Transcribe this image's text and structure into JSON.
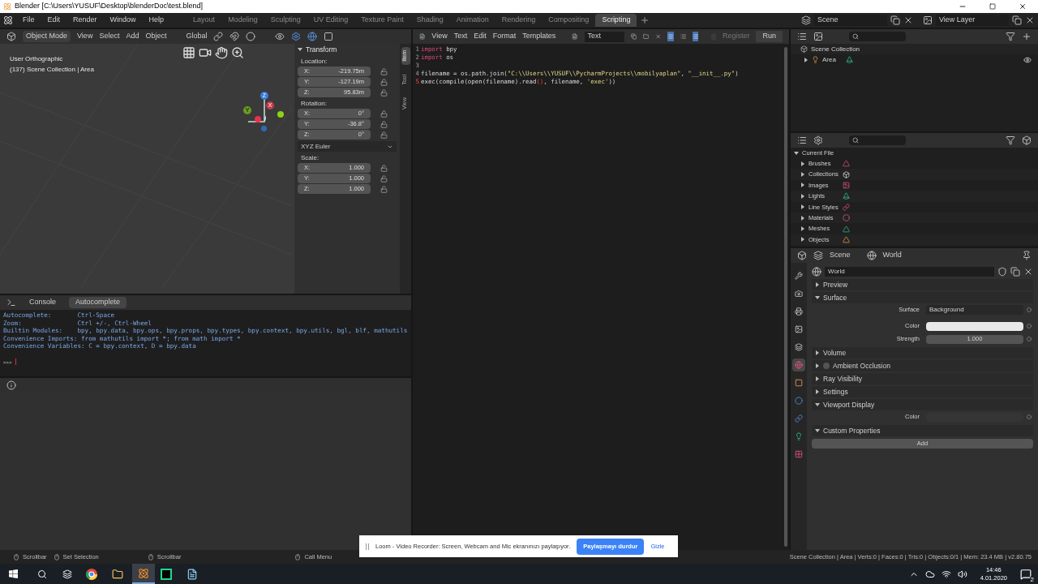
{
  "window": {
    "title": "Blender [C:\\Users\\YUSUF\\Desktop\\blenderDoc\\test.blend]"
  },
  "menu": [
    "File",
    "Edit",
    "Render",
    "Window",
    "Help"
  ],
  "workspaces": [
    {
      "label": "Layout",
      "selected": false
    },
    {
      "label": "Modeling",
      "selected": false
    },
    {
      "label": "Sculpting",
      "selected": false
    },
    {
      "label": "UV Editing",
      "selected": false
    },
    {
      "label": "Texture Paint",
      "selected": false
    },
    {
      "label": "Shading",
      "selected": false
    },
    {
      "label": "Animation",
      "selected": false
    },
    {
      "label": "Rendering",
      "selected": false
    },
    {
      "label": "Compositing",
      "selected": false
    },
    {
      "label": "Scripting",
      "selected": true
    }
  ],
  "scene": "Scene",
  "view_layer": "View Layer",
  "viewport": {
    "mode": "Object Mode",
    "menus": [
      "View",
      "Select",
      "Add",
      "Object"
    ],
    "orientation": "Global",
    "overlay_lines": [
      "User Orthographic",
      "(137) Scene Collection | Area"
    ],
    "gizmo": {
      "z": "Z",
      "x": "X",
      "y": "Y"
    },
    "sidebar_tabs": [
      {
        "label": "Item",
        "selected": true
      },
      {
        "label": "Tool",
        "selected": false
      },
      {
        "label": "View",
        "selected": false
      }
    ],
    "transform": {
      "title": "Transform",
      "groups": [
        {
          "kind": "vector",
          "label": "Location:",
          "fields": [
            {
              "axis": "X:",
              "value": "-219.75m"
            },
            {
              "axis": "Y:",
              "value": "-127.19m"
            },
            {
              "axis": "Z:",
              "value": "95.83m"
            }
          ]
        },
        {
          "kind": "vector",
          "label": "Rotation:",
          "fields": [
            {
              "axis": "X:",
              "value": "0°"
            },
            {
              "axis": "Y:",
              "value": "-36.8°"
            },
            {
              "axis": "Z:",
              "value": "0°"
            }
          ]
        },
        {
          "kind": "dropdown",
          "value": "XYZ Euler"
        },
        {
          "kind": "vector",
          "label": "Scale:",
          "fields": [
            {
              "axis": "X:",
              "value": "1.000"
            },
            {
              "axis": "Y:",
              "value": "1.000"
            },
            {
              "axis": "Z:",
              "value": "1.000"
            }
          ]
        }
      ]
    }
  },
  "text_editor": {
    "menus": [
      "View",
      "Text",
      "Edit",
      "Format",
      "Templates"
    ],
    "text_name": "Text",
    "register": {
      "label": "Register",
      "checked": false
    },
    "run": "Run",
    "lines": [
      {
        "number": "1",
        "current": false,
        "tokens": [
          {
            "kind": "keyword",
            "text": "import"
          },
          {
            "kind": "plain",
            "text": " bpy"
          }
        ]
      },
      {
        "number": "2",
        "current": false,
        "tokens": [
          {
            "kind": "keyword",
            "text": "import"
          },
          {
            "kind": "plain",
            "text": " os"
          }
        ]
      },
      {
        "number": "3",
        "current": false
      },
      {
        "number": "4",
        "current": false,
        "tokens": [
          {
            "kind": "plain",
            "text": "filename = os.path.join("
          },
          {
            "kind": "string",
            "text": "\"C:\\\\Users\\\\YUSUF\\\\PycharmProjects\\\\mobilyaplan\""
          },
          {
            "kind": "plain",
            "text": ", "
          },
          {
            "kind": "string",
            "text": "\"__init__.py\""
          },
          {
            "kind": "plain",
            "text": ")"
          }
        ]
      },
      {
        "number": "5",
        "current": true,
        "tokens": [
          {
            "kind": "plain",
            "text": "exec(compile(open(filename).read"
          },
          {
            "kind": "bracket",
            "text": "()"
          },
          {
            "kind": "plain",
            "text": ", filename, "
          },
          {
            "kind": "string",
            "text": "'exec'"
          },
          {
            "kind": "plain",
            "text": "))"
          }
        ]
      }
    ]
  },
  "console": {
    "tabs": [
      {
        "label": "Console",
        "selected": false
      },
      {
        "label": "Autocomplete",
        "selected": true
      }
    ],
    "lines": [
      "Autocomplete:       Ctrl-Space",
      "Zoom:               Ctrl +/-, Ctrl-Wheel",
      "Builtin Modules:    bpy, bpy.data, bpy.ops, bpy.props, bpy.types, bpy.context, bpy.utils, bgl, blf, mathutils",
      "Convenience Imports: from mathutils import *; from math import *",
      "Convenience Variables: C = bpy.context, D = bpy.data"
    ],
    "prompt": ">>>"
  },
  "outliner": {
    "root": "Scene Collection",
    "items": [
      {
        "label": "Area",
        "expanded": false,
        "visible": true
      }
    ]
  },
  "data_outliner": {
    "root": "Current File",
    "expanded": true,
    "items": [
      "Brushes",
      "Collections",
      "Images",
      "Lights",
      "Line Styles",
      "Materials",
      "Meshes",
      "Objects"
    ]
  },
  "properties": {
    "breadcrumb": [
      "Scene",
      "World"
    ],
    "world_name": "World",
    "tabs": [
      {
        "kind": "tool",
        "selected": false
      },
      {
        "kind": "render",
        "selected": false
      },
      {
        "kind": "output",
        "selected": false
      },
      {
        "kind": "view_layer",
        "selected": false
      },
      {
        "kind": "scene",
        "selected": false
      },
      {
        "kind": "world",
        "selected": true
      },
      {
        "kind": "object",
        "selected": false
      },
      {
        "kind": "physics",
        "selected": false
      },
      {
        "kind": "constraints",
        "selected": false
      },
      {
        "kind": "data",
        "selected": false
      },
      {
        "kind": "texture",
        "selected": false
      }
    ],
    "panels": [
      {
        "label": "Preview",
        "expanded": false
      },
      {
        "label": "Surface",
        "expanded": true,
        "rows": [
          {
            "kind": "dropdown",
            "label": "Surface",
            "value": "Background"
          },
          {
            "kind": "swatch",
            "label": "Color"
          },
          {
            "kind": "number",
            "label": "Strength",
            "value": "1.000"
          }
        ]
      },
      {
        "label": "Volume",
        "expanded": false
      },
      {
        "label": "Ambient Occlusion",
        "expanded": false,
        "checked": false
      },
      {
        "label": "Ray Visibility",
        "expanded": false
      },
      {
        "label": "Settings",
        "expanded": false
      },
      {
        "label": "Viewport Display",
        "expanded": true,
        "rows": [
          {
            "kind": "empty",
            "label": "Color"
          }
        ]
      },
      {
        "label": "Custom Properties",
        "expanded": true,
        "rows": [
          {
            "kind": "button",
            "value": "Add"
          }
        ]
      }
    ]
  },
  "status_bar": {
    "left": [
      "Scrollbar",
      "Set Selection",
      "Scrollbar",
      "Call Menu"
    ],
    "right": "Scene Collection | Area | Verts:0 | Faces:0 | Tris:0 | Objects:0/1 | Mem: 23.4 MB | v2.80.75"
  },
  "notification": {
    "text": "Loom - Video Recorder: Screen, Webcam and Mic ekranınızı paylaşıyor.",
    "stop": "Paylaşmayı durdur",
    "hide": "Gizle"
  },
  "taskbar": {
    "time": "14:46",
    "date": "4.01.2020",
    "notifications": "2"
  }
}
